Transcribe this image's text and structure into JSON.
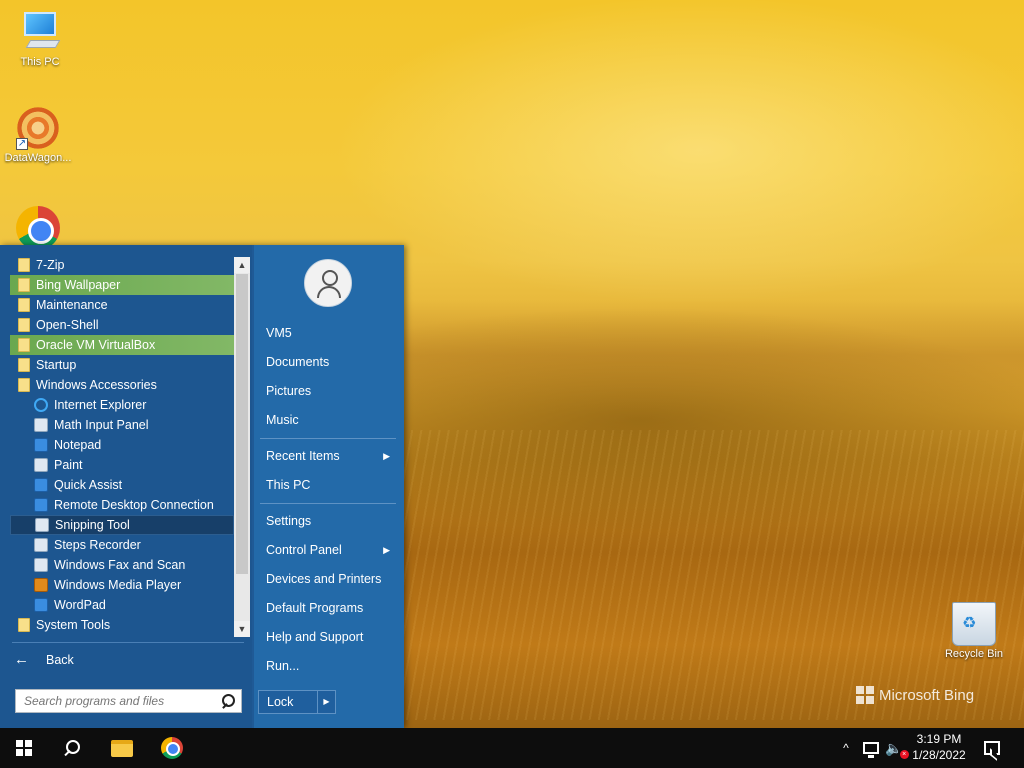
{
  "desktop": {
    "icons": [
      {
        "label": "This PC",
        "icon": "computer-icon"
      },
      {
        "label": "DataWagon...",
        "icon": "app-star-icon"
      },
      {
        "label": "",
        "icon": "chrome-icon"
      },
      {
        "label": "Recycle Bin",
        "icon": "recycle-bin-icon"
      }
    ],
    "watermark": "Microsoft Bing"
  },
  "start_menu": {
    "programs": [
      {
        "label": "7-Zip",
        "icon": "folder-icon",
        "state": "normal"
      },
      {
        "label": "Bing Wallpaper",
        "icon": "folder-icon",
        "state": "highlighted"
      },
      {
        "label": "Maintenance",
        "icon": "folder-icon",
        "state": "normal"
      },
      {
        "label": "Open-Shell",
        "icon": "folder-icon",
        "state": "normal"
      },
      {
        "label": "Oracle VM VirtualBox",
        "icon": "folder-icon",
        "state": "highlighted"
      },
      {
        "label": "Startup",
        "icon": "folder-icon",
        "state": "normal"
      },
      {
        "label": "Windows Accessories",
        "icon": "folder-icon",
        "state": "normal"
      },
      {
        "label": "Internet Explorer",
        "icon": "internet-explorer-icon",
        "state": "normal"
      },
      {
        "label": "Math Input Panel",
        "icon": "math-input-icon",
        "state": "normal"
      },
      {
        "label": "Notepad",
        "icon": "notepad-icon",
        "state": "normal"
      },
      {
        "label": "Paint",
        "icon": "paint-icon",
        "state": "normal"
      },
      {
        "label": "Quick Assist",
        "icon": "quick-assist-icon",
        "state": "normal"
      },
      {
        "label": "Remote Desktop Connection",
        "icon": "remote-desktop-icon",
        "state": "normal"
      },
      {
        "label": "Snipping Tool",
        "icon": "snipping-tool-icon",
        "state": "selected"
      },
      {
        "label": "Steps Recorder",
        "icon": "steps-recorder-icon",
        "state": "normal"
      },
      {
        "label": "Windows Fax and Scan",
        "icon": "fax-scan-icon",
        "state": "normal"
      },
      {
        "label": "Windows Media Player",
        "icon": "media-player-icon",
        "state": "normal"
      },
      {
        "label": "WordPad",
        "icon": "wordpad-icon",
        "state": "normal"
      },
      {
        "label": "System Tools",
        "icon": "folder-icon",
        "state": "normal"
      }
    ],
    "back_label": "Back",
    "search_placeholder": "Search programs and files",
    "user_name": "VM5",
    "right_items": [
      {
        "label": "Documents",
        "submenu": false
      },
      {
        "label": "Pictures",
        "submenu": false
      },
      {
        "label": "Music",
        "submenu": false
      },
      {
        "label": "Recent Items",
        "submenu": true
      },
      {
        "label": "This PC",
        "submenu": false
      },
      {
        "label": "Settings",
        "submenu": false
      },
      {
        "label": "Control Panel",
        "submenu": true
      },
      {
        "label": "Devices and Printers",
        "submenu": false
      },
      {
        "label": "Default Programs",
        "submenu": false
      },
      {
        "label": "Help and Support",
        "submenu": false
      },
      {
        "label": "Run...",
        "submenu": false
      }
    ],
    "lock_label": "Lock",
    "scroll_up": "▲",
    "scroll_down": "▼",
    "chevron": "▶"
  },
  "taskbar": {
    "time": "3:19 PM",
    "date": "1/28/2022",
    "tray_overflow": "^"
  },
  "colors": {
    "menu_bg": "#1d5690",
    "menu_right_bg": "#236aa9",
    "highlight": "#6aa84f",
    "selected": "#173f69",
    "taskbar": "#0d0d0d"
  }
}
